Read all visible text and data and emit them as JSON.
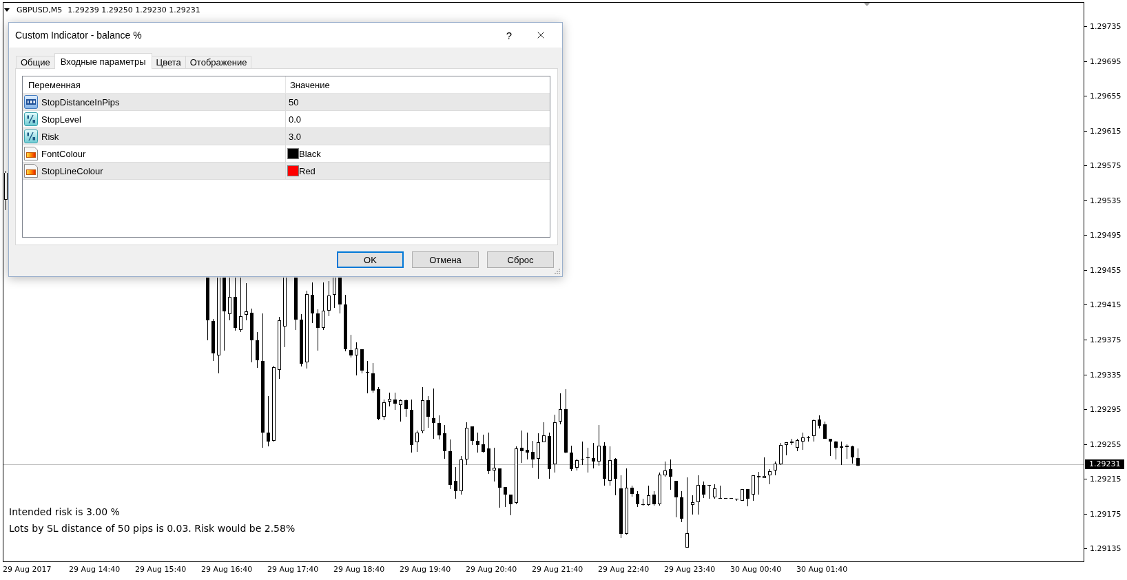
{
  "chart": {
    "symbol": "GBPUSD,M5",
    "quote": "1.29239 1.29250 1.29230 1.29231",
    "info_lines": [
      "Intended risk is 3.00 %",
      "Lots by SL distance of 50 pips is 0.03. Risk would be 2.58%"
    ],
    "price_axis": {
      "labels": [
        "1.29735",
        "1.29695",
        "1.29655",
        "1.29615",
        "1.29575",
        "1.29535",
        "1.29495",
        "1.29455",
        "1.29415",
        "1.29375",
        "1.29335",
        "1.29295",
        "1.29255",
        "1.29215",
        "1.29175",
        "1.29135"
      ],
      "current_price": "1.29231"
    },
    "time_axis": {
      "labels": [
        "29 Aug 2017",
        "29 Aug 14:40",
        "29 Aug 15:40",
        "29 Aug 16:40",
        "29 Aug 17:40",
        "29 Aug 18:40",
        "29 Aug 19:40",
        "29 Aug 20:40",
        "29 Aug 21:40",
        "29 Aug 22:40",
        "29 Aug 23:40",
        "30 Aug 00:40",
        "30 Aug 01:40"
      ]
    }
  },
  "dialog": {
    "title": "Custom Indicator - balance %",
    "help_button": "?",
    "tabs": [
      {
        "label": "Общие",
        "selected": false
      },
      {
        "label": "Входные параметры",
        "selected": true
      },
      {
        "label": "Цвета",
        "selected": false
      },
      {
        "label": "Отображение",
        "selected": false
      }
    ],
    "table": {
      "columns": [
        "Переменная",
        "Значение"
      ],
      "rows": [
        {
          "kind": "int",
          "name": "StopDistanceInPips",
          "value": "50"
        },
        {
          "kind": "double",
          "name": "StopLevel",
          "value": "0.0"
        },
        {
          "kind": "double",
          "name": "Risk",
          "value": "3.0"
        },
        {
          "kind": "color",
          "name": "FontColour",
          "value": "Black",
          "color": "#000000"
        },
        {
          "kind": "color",
          "name": "StopLineColour",
          "value": "Red",
          "color": "#ff0000"
        }
      ]
    },
    "buttons": [
      {
        "label": "OK",
        "default": true
      },
      {
        "label": "Отмена",
        "default": false
      },
      {
        "label": "Сброс",
        "default": false
      }
    ]
  }
}
